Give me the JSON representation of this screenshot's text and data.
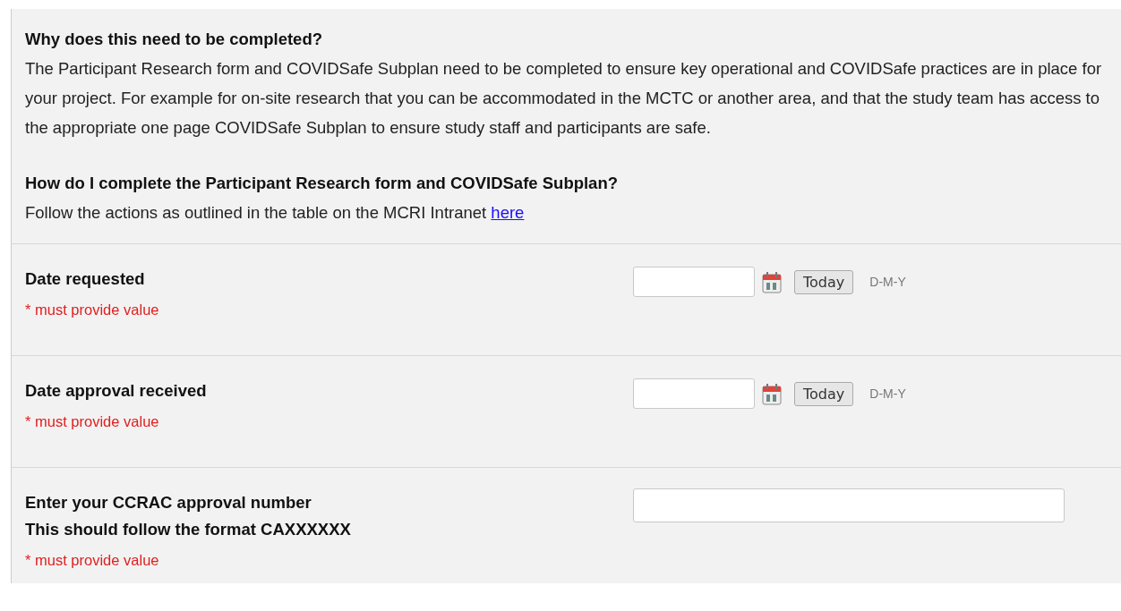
{
  "info": [
    {
      "heading": "Why does this need to be completed?",
      "text": "The Participant Research form and COVIDSafe Subplan need to be completed to ensure key operational and COVIDSafe practices are in place for your project. For example for on-site research that you can be accommodated in the MCTC or another area, and that the study team has access to the appropriate one page COVIDSafe Subplan to ensure study staff and participants are safe."
    },
    {
      "heading": "How do I complete the Participant Research form and COVIDSafe Subplan?",
      "text": "Follow the actions as outlined in the table on the MCRI Intranet ",
      "link": "here"
    }
  ],
  "fields": [
    {
      "kind": "date",
      "label": [
        "Date requested"
      ],
      "required": "* must provide value",
      "button": "Today",
      "format": "D-M-Y"
    },
    {
      "kind": "date",
      "label": [
        "Date approval received"
      ],
      "required": "* must provide value",
      "button": "Today",
      "format": "D-M-Y"
    },
    {
      "kind": "text",
      "label": [
        "Enter your CCRAC approval number",
        "This should follow the format CAXXXXXX"
      ],
      "required": "* must provide value"
    }
  ]
}
